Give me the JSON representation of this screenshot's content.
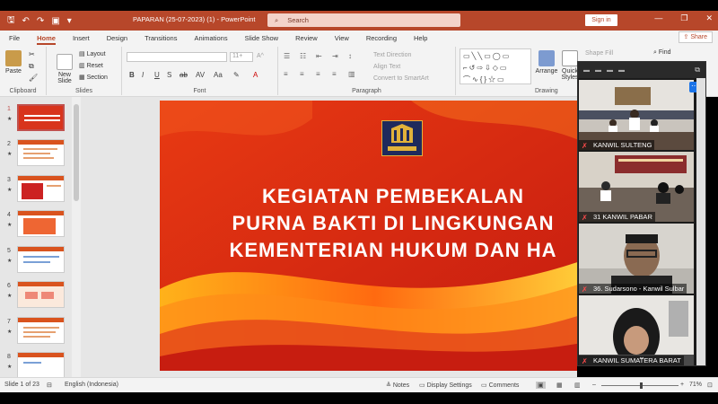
{
  "titlebar": {
    "doc_title": "PAPARAN (25-07-2023) (1)  -  PowerPoint",
    "search_placeholder": "Search",
    "signin": "Sign in",
    "minimize": "—",
    "restore": "❐",
    "close": "✕"
  },
  "tabs": [
    "File",
    "Home",
    "Insert",
    "Design",
    "Transitions",
    "Animations",
    "Slide Show",
    "Review",
    "View",
    "Recording",
    "Help"
  ],
  "share": "Share",
  "ribbon": {
    "clipboard": {
      "label": "Clipboard",
      "paste": "Paste"
    },
    "slides": {
      "label": "Slides",
      "new_slide": "New Slide",
      "layout": "Layout",
      "reset": "Reset",
      "section": "Section"
    },
    "font": {
      "label": "Font",
      "size": "11+"
    },
    "paragraph": {
      "label": "Paragraph",
      "text_direction": "Text Direction",
      "align_text": "Align Text",
      "smartart": "Convert to SmartArt"
    },
    "drawing": {
      "label": "Drawing",
      "arrange": "Arrange",
      "styles": "Quick Styles",
      "shape_fill": "Shape Fill"
    },
    "editing": {
      "find": "Find"
    }
  },
  "thumbnails": [
    {
      "num": "1",
      "star": "★"
    },
    {
      "num": "2",
      "star": "★"
    },
    {
      "num": "3",
      "star": "★"
    },
    {
      "num": "4",
      "star": "★"
    },
    {
      "num": "5",
      "star": "★"
    },
    {
      "num": "6",
      "star": "★"
    },
    {
      "num": "7",
      "star": "★"
    },
    {
      "num": "8",
      "star": "★"
    }
  ],
  "slide": {
    "line1": "KEGIATAN PEMBEKALAN",
    "line2": "PURNA BAKTI DI LINGKUNGAN",
    "line3": "KEMENTERIAN HUKUM DAN HA",
    "bg_color": "#d8341c"
  },
  "video_panel": {
    "tiles": [
      {
        "label": "KANWIL SULTENG"
      },
      {
        "label": "31 KANWIL PABAR"
      },
      {
        "label": "36. Sudarsono - Kanwil Sulbar"
      },
      {
        "label": "KANWIL SUMATERA BARAT"
      }
    ]
  },
  "statusbar": {
    "slide_info": "Slide 1 of 23",
    "language": "English (Indonesia)",
    "notes": "Notes",
    "display_settings": "Display Settings",
    "comments": "Comments",
    "zoom_minus": "–",
    "zoom_plus": "+",
    "zoom_level": "71%"
  },
  "colors": {
    "accent": "#b7472a",
    "selection": "#c0504d"
  }
}
